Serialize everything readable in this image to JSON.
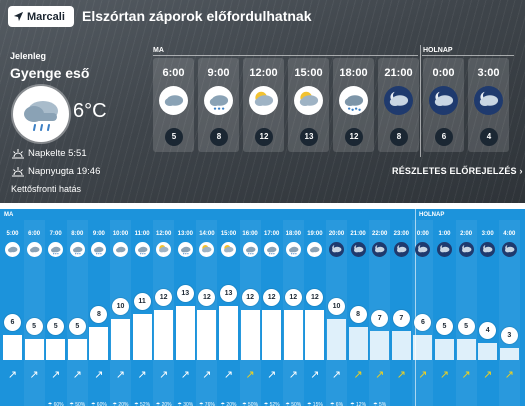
{
  "header": {
    "location_button": "Marcali",
    "headline": "Elszórtan záporok előfordulhatnak",
    "location_icon": "location-arrow-icon"
  },
  "current": {
    "label": "Jelenleg",
    "description": "Gyenge eső",
    "temperature": "6°C",
    "icon": "light-rain-cloud-icon",
    "sunrise": "Napkelte 5:51",
    "sunset": "Napnyugta 19:46",
    "front": "Kettősfronti hatás"
  },
  "top_forecast": {
    "today_label": "MA",
    "tomorrow_label": "HOLNAP",
    "detail_link": "RÉSZLETES ELŐREJELZÉS",
    "columns": [
      {
        "time": "6:00",
        "icon": "cloudy-icon",
        "value": "5",
        "night": false
      },
      {
        "time": "9:00",
        "icon": "light-rain-icon",
        "value": "8",
        "night": false
      },
      {
        "time": "12:00",
        "icon": "partly-cloudy-icon",
        "value": "12",
        "night": false
      },
      {
        "time": "15:00",
        "icon": "partly-cloudy-icon",
        "value": "13",
        "night": false
      },
      {
        "time": "18:00",
        "icon": "rain-cloud-icon",
        "value": "12",
        "night": false
      },
      {
        "time": "21:00",
        "icon": "night-partly-cloudy-icon",
        "value": "8",
        "night": true
      },
      {
        "time": "0:00",
        "icon": "night-partly-cloudy-icon",
        "value": "6",
        "night": true
      },
      {
        "time": "3:00",
        "icon": "night-partly-cloudy-icon",
        "value": "4",
        "night": true
      }
    ]
  },
  "hourly": {
    "today_label": "MA",
    "tomorrow_label": "HOLNAP",
    "columns": [
      {
        "time": "5:00",
        "temp": 6,
        "prob": "",
        "icon": "overcast-icon",
        "night": false,
        "warn": false
      },
      {
        "time": "6:00",
        "temp": 5,
        "prob": "",
        "icon": "overcast-icon",
        "night": false,
        "warn": false
      },
      {
        "time": "7:00",
        "temp": 5,
        "prob": "60%",
        "icon": "light-rain-icon",
        "night": false,
        "warn": false
      },
      {
        "time": "8:00",
        "temp": 5,
        "prob": "50%",
        "icon": "light-rain-icon",
        "night": false,
        "warn": false
      },
      {
        "time": "9:00",
        "temp": 8,
        "prob": "60%",
        "icon": "light-rain-icon",
        "night": false,
        "warn": false
      },
      {
        "time": "10:00",
        "temp": 10,
        "prob": "20%",
        "icon": "overcast-icon",
        "night": false,
        "warn": false
      },
      {
        "time": "11:00",
        "temp": 11,
        "prob": "52%",
        "icon": "rain-icon",
        "night": false,
        "warn": false
      },
      {
        "time": "12:00",
        "temp": 12,
        "prob": "20%",
        "icon": "partly-cloudy-icon",
        "night": false,
        "warn": false
      },
      {
        "time": "13:00",
        "temp": 13,
        "prob": "30%",
        "icon": "light-rain-icon",
        "night": false,
        "warn": false
      },
      {
        "time": "14:00",
        "temp": 12,
        "prob": "76%",
        "icon": "partly-cloudy-icon",
        "night": false,
        "warn": false
      },
      {
        "time": "15:00",
        "temp": 13,
        "prob": "20%",
        "icon": "partly-cloudy-icon",
        "night": false,
        "warn": false
      },
      {
        "time": "16:00",
        "temp": 12,
        "prob": "50%",
        "icon": "light-rain-icon",
        "night": false,
        "warn": true
      },
      {
        "time": "17:00",
        "temp": 12,
        "prob": "52%",
        "icon": "light-rain-icon",
        "night": false,
        "warn": false
      },
      {
        "time": "18:00",
        "temp": 12,
        "prob": "50%",
        "icon": "light-rain-icon",
        "night": false,
        "warn": false
      },
      {
        "time": "19:00",
        "temp": 12,
        "prob": "15%",
        "icon": "overcast-icon",
        "night": false,
        "warn": false
      },
      {
        "time": "20:00",
        "temp": 10,
        "prob": "6%",
        "icon": "night-partly-cloudy-icon",
        "night": true,
        "warn": false
      },
      {
        "time": "21:00",
        "temp": 8,
        "prob": "12%",
        "icon": "night-partly-cloudy-icon",
        "night": true,
        "warn": true
      },
      {
        "time": "22:00",
        "temp": 7,
        "prob": "5%",
        "icon": "night-partly-cloudy-icon",
        "night": true,
        "warn": true
      },
      {
        "time": "23:00",
        "temp": 7,
        "prob": "",
        "icon": "night-partly-cloudy-icon",
        "night": true,
        "warn": true
      },
      {
        "time": "0:00",
        "temp": 6,
        "prob": "",
        "icon": "night-partly-cloudy-icon",
        "night": true,
        "warn": true
      },
      {
        "time": "1:00",
        "temp": 5,
        "prob": "",
        "icon": "night-partly-cloudy-icon",
        "night": true,
        "warn": true
      },
      {
        "time": "2:00",
        "temp": 5,
        "prob": "",
        "icon": "night-partly-cloudy-icon",
        "night": true,
        "warn": true
      },
      {
        "time": "3:00",
        "temp": 4,
        "prob": "",
        "icon": "night-partly-cloudy-icon",
        "night": true,
        "warn": true
      },
      {
        "time": "4:00",
        "temp": 3,
        "prob": "",
        "icon": "night-partly-cloudy-icon",
        "night": true,
        "warn": true
      }
    ]
  },
  "colors": {
    "top_background": "#3f454b",
    "hourly_background": "#1c93db",
    "badge": "#1b2733",
    "night_icon": "#1f3a6e",
    "wind_warning": "#f2d21c"
  }
}
